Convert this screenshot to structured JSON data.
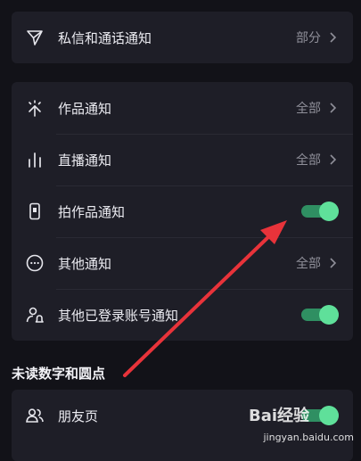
{
  "card1": {
    "rows": [
      {
        "label": "私信和通话通知",
        "value": "部分",
        "icon": "paper-plane-icon"
      }
    ]
  },
  "card2": {
    "rows": [
      {
        "label": "作品通知",
        "value": "全部",
        "icon": "sparkle-icon"
      },
      {
        "label": "直播通知",
        "value": "全部",
        "icon": "bars-icon"
      },
      {
        "label": "拍作品通知",
        "toggle_on": true,
        "icon": "phone-record-icon"
      },
      {
        "label": "其他通知",
        "value": "全部",
        "icon": "more-circle-icon"
      },
      {
        "label": "其他已登录账号通知",
        "toggle_on": true,
        "icon": "user-bell-icon"
      }
    ]
  },
  "section": {
    "title": "未读数字和圆点"
  },
  "card3": {
    "rows": [
      {
        "label": "朋友页",
        "toggle_on": true,
        "icon": "friends-icon"
      }
    ]
  },
  "annotation": {
    "arrow_color": "#e8333a"
  },
  "watermark": {
    "url": "jingyan.baidu.com",
    "logo_text": "Bai经验"
  },
  "colors": {
    "background": "#121218",
    "card": "#1e1e27",
    "toggle_on": "#5fe09a"
  }
}
